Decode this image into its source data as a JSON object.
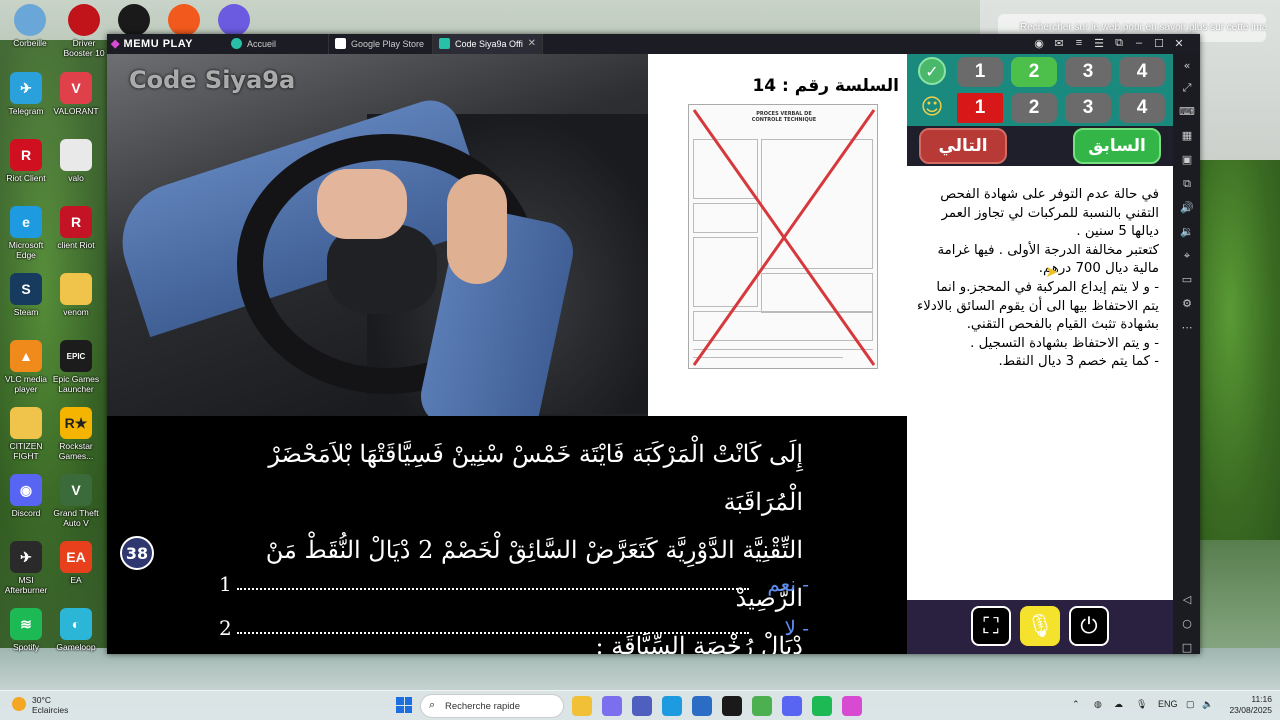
{
  "desktop": {
    "search_hint": "Rechercher sur le web pour en savoir plus sur cette image",
    "top_icons": [
      {
        "label": "Corbeille",
        "icon": "recycle-bin-icon",
        "color": "#6aa7d8"
      },
      {
        "label": "Driver Booster 10",
        "icon": "driver-booster-icon",
        "color": "#c0141a"
      },
      {
        "label": "",
        "icon": "logitech-g-icon",
        "color": "#1a1a1a"
      },
      {
        "label": "",
        "icon": "brave-icon",
        "color": "#f25a1d"
      },
      {
        "label": "",
        "icon": "microsoft-copilot-icon",
        "color": "#6b5be0"
      }
    ],
    "icons": [
      {
        "label": "Telegram",
        "icon": "telegram-icon",
        "color": "#2aa1da",
        "glyph": "✈"
      },
      {
        "label": "VALORANT",
        "icon": "valorant-icon",
        "color": "#e0404a",
        "glyph": "V"
      },
      {
        "label": "Riot Client",
        "icon": "riot-client-icon",
        "color": "#d01020",
        "glyph": "R"
      },
      {
        "label": "valo",
        "icon": "file-icon",
        "color": "#e9e9e9",
        "glyph": ""
      },
      {
        "label": "Microsoft Edge",
        "icon": "edge-icon",
        "color": "#1e9be0",
        "glyph": "e"
      },
      {
        "label": "client Riot",
        "icon": "riot-client-icon",
        "color": "#c51326",
        "glyph": "R"
      },
      {
        "label": "Steam",
        "icon": "steam-icon",
        "color": "#173a5f",
        "glyph": "S"
      },
      {
        "label": "venom",
        "icon": "folder-icon",
        "color": "#f0c44a",
        "glyph": ""
      },
      {
        "label": "VLC media player",
        "icon": "vlc-icon",
        "color": "#f08a1a",
        "glyph": "▲"
      },
      {
        "label": "Epic Games Launcher",
        "icon": "epic-games-icon",
        "color": "#1c1c1c",
        "glyph": "EPIC"
      },
      {
        "label": "CITIZEN FIGHT",
        "icon": "folder-icon",
        "color": "#f0c44a",
        "glyph": ""
      },
      {
        "label": "Rockstar Games...",
        "icon": "rockstar-icon",
        "color": "#f5b400",
        "glyph": "R★"
      },
      {
        "label": "Discord",
        "icon": "discord-icon",
        "color": "#5865f2",
        "glyph": "◉"
      },
      {
        "label": "Grand Theft Auto V",
        "icon": "gta-icon",
        "color": "#3b6b3a",
        "glyph": "V"
      },
      {
        "label": "MSI Afterburner",
        "icon": "msi-afterburner-icon",
        "color": "#2a2a2a",
        "glyph": "✈"
      },
      {
        "label": "EA",
        "icon": "ea-icon",
        "color": "#e8401c",
        "glyph": "EA"
      },
      {
        "label": "Spotify",
        "icon": "spotify-icon",
        "color": "#1db954",
        "glyph": "≋"
      },
      {
        "label": "Gameloop",
        "icon": "gameloop-icon",
        "color": "#2bb6d8",
        "glyph": "◐"
      }
    ]
  },
  "memu": {
    "logo": "MEMU PLAY",
    "tabs": [
      {
        "label": "Accueil",
        "icon": "home-icon",
        "color": "#27c0a8"
      },
      {
        "label": "Google Play Store",
        "icon": "play-store-icon",
        "color": "#ffffff"
      },
      {
        "label": "Code Siya9a Offi",
        "icon": "app-icon",
        "color": "#27c0a8"
      }
    ],
    "window_controls": [
      "account-icon",
      "mail-icon",
      "menu-icon",
      "list-icon",
      "restore-icon",
      "minimize-icon",
      "maximize-icon",
      "close-icon",
      "collapse-icon"
    ],
    "sidebar_icons": [
      "fullscreen-icon",
      "keyboard-icon",
      "virtualization-icon",
      "rpm-icon",
      "multi-window-icon",
      "volume-up-icon",
      "volume-down-icon",
      "location-icon",
      "folder-icon",
      "settings-icon",
      "more-icon",
      "back-icon",
      "home-circle-icon",
      "recent-apps-icon"
    ]
  },
  "game": {
    "watermark": "Code Siya9a",
    "series_title": "السلسة رقم : 14",
    "document": {
      "heading": "PROCES VERBAL DE CONTROLE TECHNIQUE"
    },
    "question_lines": [
      "إِلَى كَانْتْ الْمَرْكَبَة فَايْتَة خَمْسْ سْنِينْ فَسِيَّاقَتْهَا بْلاَمَحْضَرْ الْمُرَاقَبَة",
      "التِّقْنِيَّة الدَّوْرِيَّة كَتَعَرَّضْ السَّائِقْ لْخَصْمْ 2 دْيَالْ النُّقَطْ مَنْ الرَّصِيدْ",
      "دْيَالْ رُخْصَة السِّيَّاقَة :"
    ],
    "question_number": "38",
    "answers": [
      {
        "number": "1",
        "label": "- نعم"
      },
      {
        "number": "2",
        "label": "- لا"
      }
    ]
  },
  "panel": {
    "correct_row": {
      "badge": "check-icon",
      "choices": [
        "1",
        "2",
        "3",
        "4"
      ],
      "selected": 1
    },
    "user_row": {
      "badge": "user-icon",
      "choices": [
        "1",
        "2",
        "3",
        "4"
      ],
      "selected": 0
    },
    "next_label": "التالي",
    "prev_label": "السابق",
    "explanation": [
      "في حالة عدم التوفر على شهادة الفحص التقني بالنسبة للمركبات لي تجاوز العمر ديالها 5 سنين .",
      "كتعتبر مخالفة الدرجة الأولى . فيها غرامة مالية ديال 700 درهم.",
      "- و لا يتم إيداع المركبة في المحجز.و انما يتم الاحتفاظ بيها الى أن يقوم السائق بالادلاء بشهادة تثبث القيام بالفحص التقني.",
      "- و يتم الاحتفاظ بشهادة التسجيل .",
      "- كما يتم خصم 3 ديال النقط."
    ],
    "bottom_buttons": [
      "screenshot-icon",
      "microphone-icon",
      "power-icon"
    ]
  },
  "taskbar": {
    "weather_temp": "30°C",
    "weather_desc": "Eclaircies",
    "search_placeholder": "Recherche rapide",
    "apps": [
      {
        "icon": "file-explorer-icon",
        "color": "#f2c037"
      },
      {
        "icon": "copilot-icon",
        "color": "#7b6ff0"
      },
      {
        "icon": "teams-icon",
        "color": "#4e5fbf"
      },
      {
        "icon": "edge-icon",
        "color": "#1e9be0"
      },
      {
        "icon": "store-icon",
        "color": "#2b6cc4"
      },
      {
        "icon": "logitech-icon",
        "color": "#1a1a1a"
      },
      {
        "icon": "chrome-icon",
        "color": "#4caf50"
      },
      {
        "icon": "discord-icon",
        "color": "#5865f2"
      },
      {
        "icon": "spotify-icon",
        "color": "#1db954"
      },
      {
        "icon": "memu-icon",
        "color": "#d94ad3"
      }
    ],
    "language": "ENG",
    "time": "11:16",
    "date": "23/08/2025"
  }
}
